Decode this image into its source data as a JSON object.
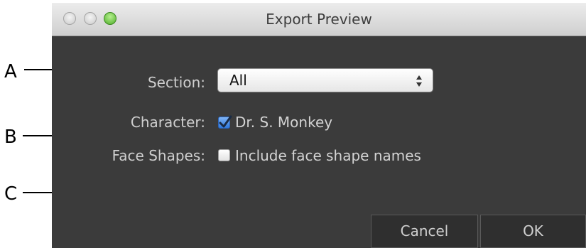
{
  "window": {
    "title": "Export Preview"
  },
  "form": {
    "section_label": "Section:",
    "section_value": "All",
    "character_label": "Character:",
    "character_option": "Dr. S. Monkey",
    "character_checked": true,
    "face_shapes_label": "Face Shapes:",
    "face_shapes_option": "Include face shape names",
    "face_shapes_checked": false
  },
  "buttons": {
    "cancel": "Cancel",
    "ok": "OK"
  },
  "callouts": {
    "a": "A",
    "b": "B",
    "c": "C"
  },
  "colors": {
    "dialog_bg": "#3b3b3b",
    "accent_checkbox": "#2f78dd",
    "zoom_button": "#4fae2a"
  }
}
